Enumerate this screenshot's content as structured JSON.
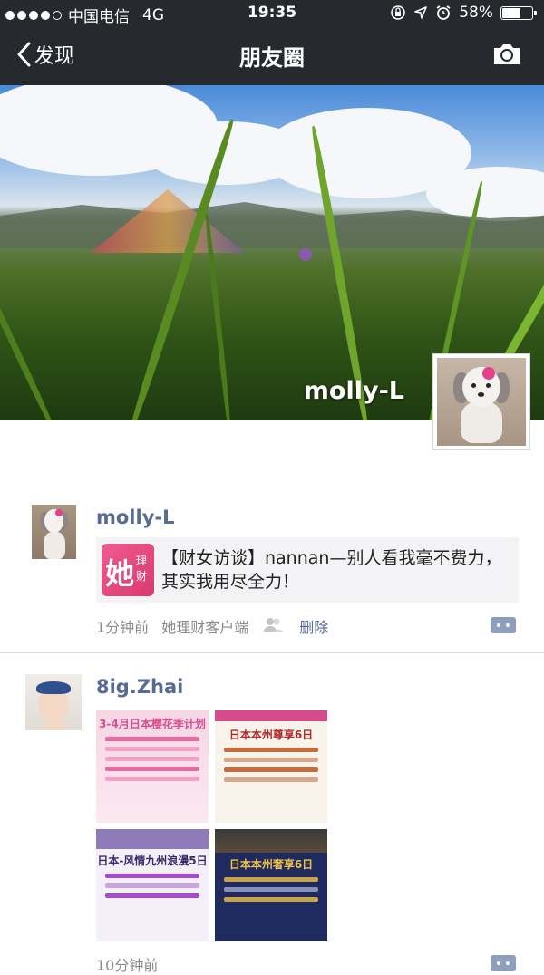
{
  "status": {
    "carrier": "中国电信",
    "network": "4G",
    "time": "19:35",
    "battery": "58%",
    "battery_level": 0.58
  },
  "nav": {
    "back_label": "发现",
    "title": "朋友圈"
  },
  "cover": {
    "username": "molly-L"
  },
  "posts": [
    {
      "author": "molly-L",
      "link_logo_char": "她",
      "link_logo_sub": "理财",
      "link_text": "【财女访谈】nannan—别人看我毫不费力，其实我用尽全力！",
      "time": "1分钟前",
      "source": "她理财客户端",
      "delete": "删除"
    },
    {
      "author": "8ig.Zhai",
      "time": "10分钟前",
      "posters": [
        "3-4月日本樱花季计划",
        "日本本州尊享6日",
        "日本-风情九州浪漫5日",
        "日本本州奢享6日"
      ]
    }
  ]
}
